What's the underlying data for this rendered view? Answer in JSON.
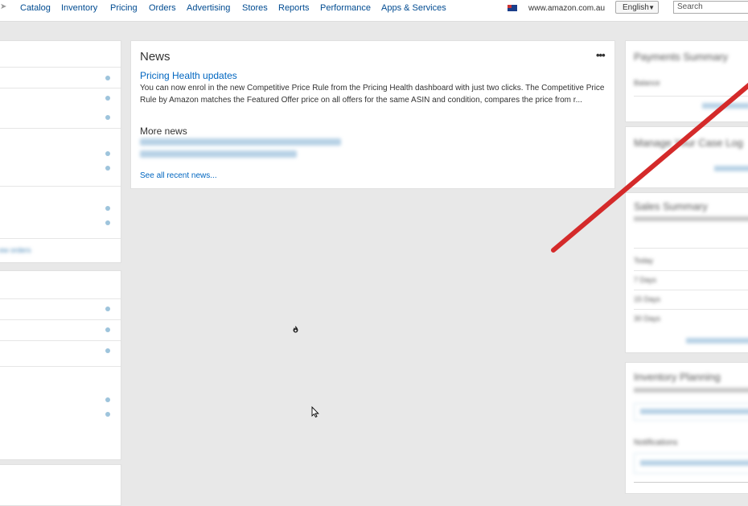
{
  "nav": {
    "items": [
      "Catalog",
      "Inventory",
      "Pricing",
      "Orders",
      "Advertising",
      "Stores",
      "Reports",
      "Performance",
      "Apps & Services"
    ],
    "domain": "www.amazon.com.au",
    "language": "English",
    "search_placeholder": "Search"
  },
  "news": {
    "title": "News",
    "menu": "•••",
    "headline": "Pricing Health updates",
    "body": "You can now enrol in the new Competitive Price Rule from the Pricing Health dashboard with just two clicks. The Competitive Price Rule by Amazon matches the Featured Offer price on all offers for the same ASIN and condition, compares the price from r...",
    "more_title": "More news",
    "see_all": "See all recent news..."
  },
  "left_panel": {
    "link": "ew orders"
  },
  "right_panel": {
    "payments_title": "Payments Summary",
    "balance_label": "Balance",
    "manage_title": "Manage Your Case Log",
    "sales_title": "Sales Summary",
    "sales_rows": [
      "Today",
      "7 Days",
      "15 Days",
      "30 Days"
    ],
    "inventory_title": "Inventory Planning",
    "notifications_label": "Notifications"
  }
}
